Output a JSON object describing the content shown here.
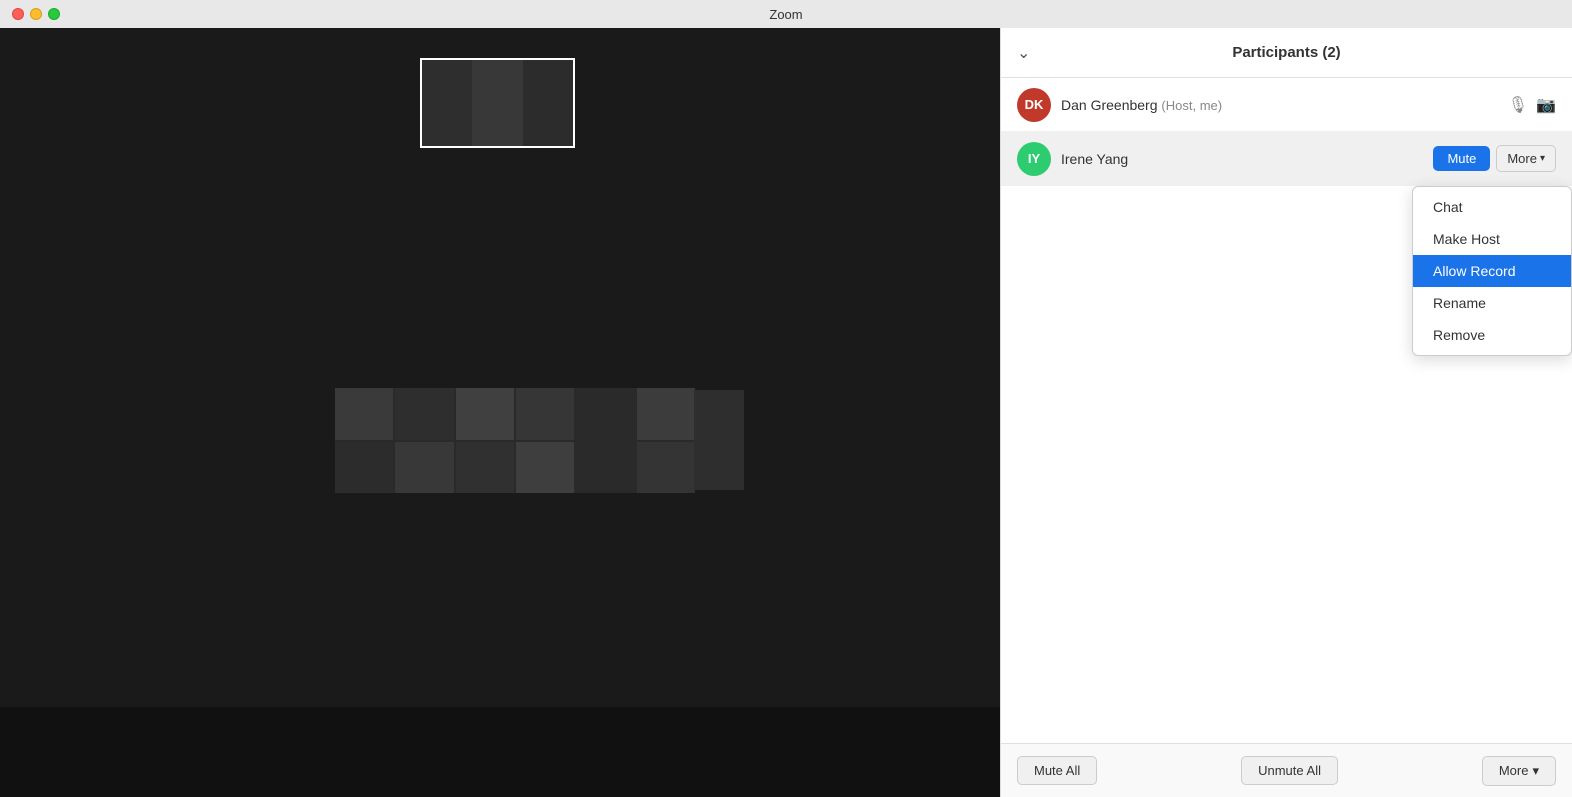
{
  "titleBar": {
    "title": "Zoom"
  },
  "participantsPanel": {
    "header": {
      "title": "Participants (2)"
    },
    "participants": [
      {
        "id": "dk",
        "initials": "DK",
        "name": "Dan Greenberg",
        "role": "(Host, me)",
        "avatarColor": "#c0392b"
      },
      {
        "id": "iy",
        "initials": "IY",
        "name": "Irene Yang",
        "role": "",
        "avatarColor": "#2ecc71"
      }
    ],
    "actions": {
      "mute": "Mute",
      "more": "More",
      "chat": "Chat",
      "makeHost": "Make Host",
      "allowRecord": "Allow Record",
      "rename": "Rename",
      "remove": "Remove"
    },
    "footer": {
      "muteAll": "Mute All",
      "unmuteAll": "Unmute All",
      "more": "More"
    }
  }
}
